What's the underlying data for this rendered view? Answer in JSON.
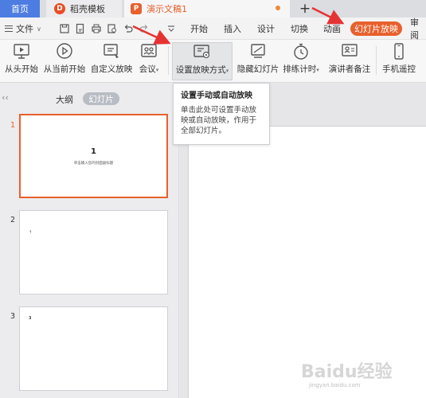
{
  "tabs": {
    "home": "首页",
    "templates": "稻壳模板",
    "document": "演示文稿1",
    "add": "+"
  },
  "menu": {
    "file": "文件",
    "file_dropdown": "∨",
    "items": [
      "开始",
      "插入",
      "设计",
      "切换",
      "动画"
    ],
    "active": "幻灯片放映",
    "partial": "审阅"
  },
  "ribbon": {
    "from_start": "从头开始",
    "from_current": "从当前开始",
    "custom_show": "自定义放映",
    "meeting": "会议",
    "setup_show": "设置放映方式",
    "hide_slide": "隐藏幻灯片",
    "rehearse": "排练计时",
    "presenter_notes": "演讲者备注",
    "phone_remote": "手机遥控"
  },
  "panel": {
    "collapse": "‹‹",
    "outline": "大纲",
    "slides": "幻灯片"
  },
  "slides": [
    {
      "num": "1",
      "title": "1",
      "subtitle": "单击输入您的封面副标题"
    },
    {
      "num": "2",
      "text": "↑"
    },
    {
      "num": "3",
      "text": "3"
    }
  ],
  "tooltip": {
    "title": "设置手动或自动放映",
    "body": "单击此处可设置手动放映或自动放映，作用于全部幻灯片。"
  },
  "watermark": {
    "logo": "Baidu经验",
    "url": "jingyan.baidu.com"
  },
  "colors": {
    "accent": "#e8602c",
    "home_tab": "#4d7de0",
    "arrow": "#e53333"
  }
}
